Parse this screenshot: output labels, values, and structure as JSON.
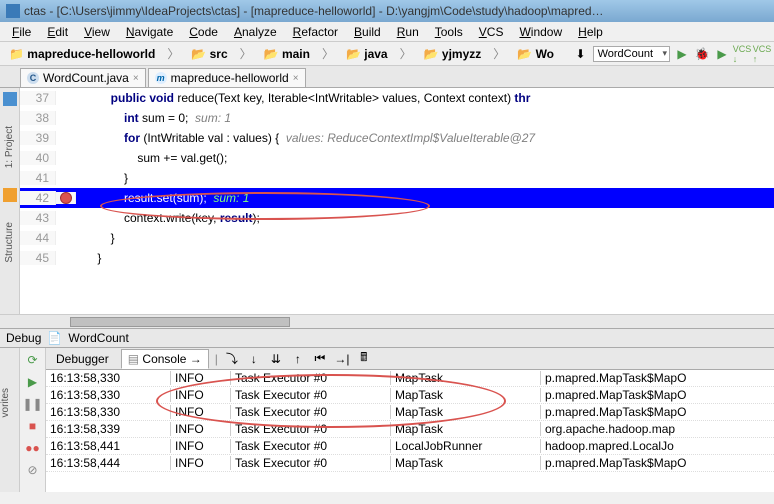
{
  "title": "ctas - [C:\\Users\\jimmy\\IdeaProjects\\ctas] - [mapreduce-helloworld] - D:\\yangjm\\Code\\study\\hadoop\\mapred…",
  "menu": [
    "File",
    "Edit",
    "View",
    "Navigate",
    "Code",
    "Analyze",
    "Refactor",
    "Build",
    "Run",
    "Tools",
    "VCS",
    "Window",
    "Help"
  ],
  "breadcrumb": [
    "mapreduce-helloworld",
    "src",
    "main",
    "java",
    "yjmyzz",
    "Wo"
  ],
  "run_config": "WordCount",
  "tabs": [
    {
      "icon": "C",
      "label": "WordCount.java"
    },
    {
      "icon": "m",
      "label": "mapreduce-helloworld"
    }
  ],
  "left_labels": [
    "1: Project",
    "Structure"
  ],
  "code": {
    "lines": [
      {
        "n": 37,
        "bp": false,
        "hl": false,
        "html": "        <span class='kw'>public void</span> reduce(Text key, Iterable&lt;IntWritable&gt; values, Context context) <span class='kw'>thr</span>"
      },
      {
        "n": 38,
        "bp": false,
        "hl": false,
        "html": "            <span class='kw'>int</span> sum = 0;  <span class='comment'>sum: 1</span>"
      },
      {
        "n": 39,
        "bp": false,
        "hl": false,
        "html": "            <span class='kw'>for</span> (IntWritable val : values) {  <span class='comment'>values: ReduceContextImpl$ValueIterable@27</span>"
      },
      {
        "n": 40,
        "bp": false,
        "hl": false,
        "html": "                sum += val.get();"
      },
      {
        "n": 41,
        "bp": false,
        "hl": false,
        "html": "            }"
      },
      {
        "n": 42,
        "bp": true,
        "hl": true,
        "html": "            result.set(sum);  <span class='comment'>sum: 1</span>"
      },
      {
        "n": 43,
        "bp": false,
        "hl": false,
        "html": "            context.write(key, <span class='kw'>result</span>);"
      },
      {
        "n": 44,
        "bp": false,
        "hl": false,
        "html": "        }"
      },
      {
        "n": 45,
        "bp": false,
        "hl": false,
        "html": "    }"
      }
    ]
  },
  "debug_label": "Debug",
  "debug_target": "WordCount",
  "debugger_tab": "Debugger",
  "console_tab": "Console",
  "console_rows": [
    {
      "t": "16:13:58,330",
      "lvl": "INFO",
      "thr": "Task Executor #0",
      "cls": "MapTask",
      "msg": "p.mapred.MapTask$MapO"
    },
    {
      "t": "16:13:58,330",
      "lvl": "INFO",
      "thr": "Task Executor #0",
      "cls": "MapTask",
      "msg": "p.mapred.MapTask$MapO"
    },
    {
      "t": "16:13:58,330",
      "lvl": "INFO",
      "thr": "Task Executor #0",
      "cls": "MapTask",
      "msg": "p.mapred.MapTask$MapO"
    },
    {
      "t": "16:13:58,339",
      "lvl": "INFO",
      "thr": "Task Executor #0",
      "cls": "MapTask",
      "msg": "org.apache.hadoop.map"
    },
    {
      "t": "16:13:58,441",
      "lvl": "INFO",
      "thr": "Task Executor #0",
      "cls": "LocalJobRunner",
      "msg": "hadoop.mapred.LocalJo"
    },
    {
      "t": "16:13:58,444",
      "lvl": "INFO",
      "thr": "Task Executor #0",
      "cls": "MapTask",
      "msg": "p.mapred.MapTask$MapO"
    }
  ]
}
